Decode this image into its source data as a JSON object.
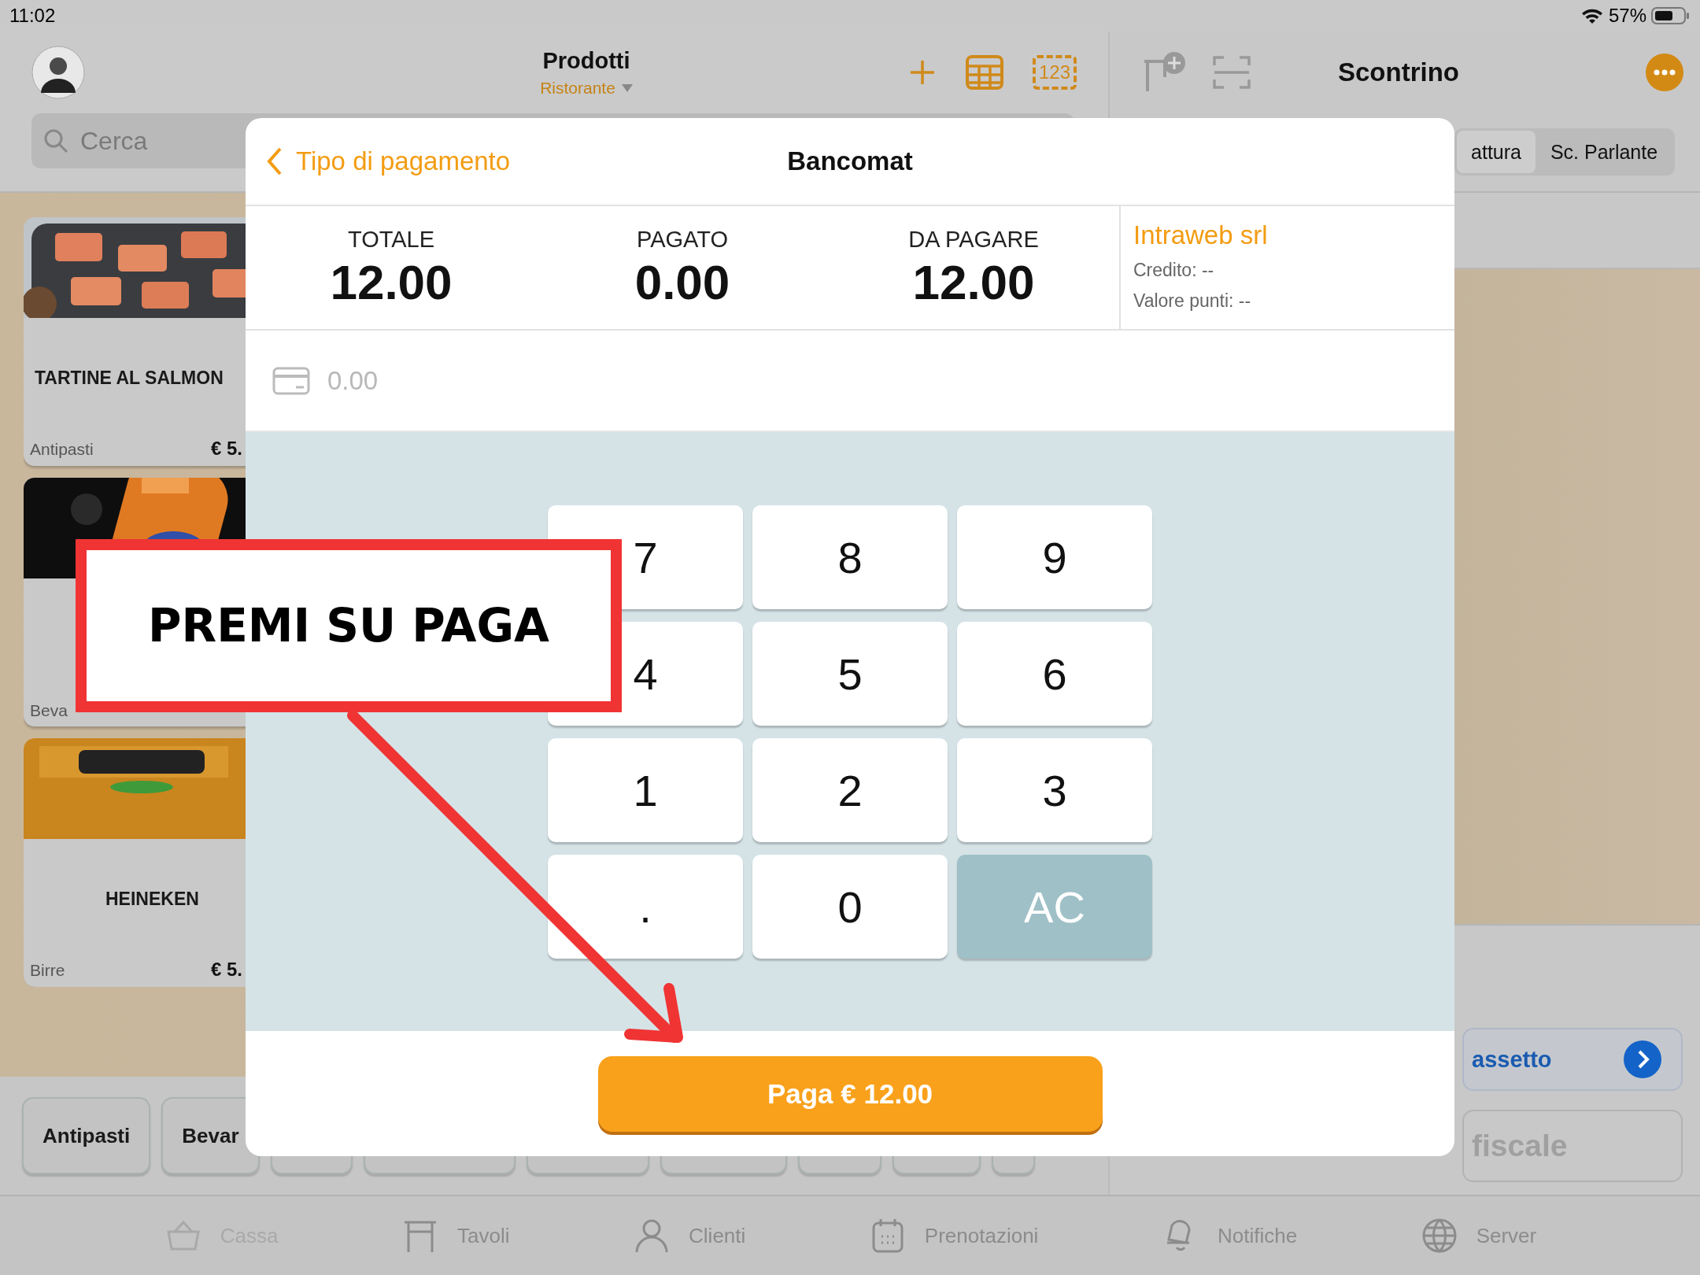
{
  "status_bar": {
    "time": "11:02",
    "battery": "57%"
  },
  "products_panel": {
    "title": "Prodotti",
    "subtitle": "Ristorante",
    "number_pad_label": "123",
    "search": {
      "placeholder": "Cerca"
    },
    "products": [
      {
        "name": "TARTINE AL SALMON",
        "category": "Antipasti",
        "price": "€ 5."
      },
      {
        "category": "Beva"
      },
      {
        "name": "HEINEKEN",
        "category": "Birre",
        "price": "€ 5."
      }
    ],
    "categories": [
      {
        "label": "Antipasti"
      },
      {
        "label": "Bevar"
      }
    ]
  },
  "receipt_panel": {
    "title": "Scontrino",
    "segments": [
      {
        "label": "attura",
        "selected": true
      },
      {
        "label": "Sc. Parlante",
        "selected": false
      }
    ],
    "drawer_button": "assetto",
    "fiscal_button": "fiscale"
  },
  "payment_dialog": {
    "back": "Tipo di pagamento",
    "title": "Bancomat",
    "totals": [
      {
        "label": "TOTALE",
        "value": "12.00"
      },
      {
        "label": "PAGATO",
        "value": "0.00"
      },
      {
        "label": "DA PAGARE",
        "value": "12.00"
      }
    ],
    "customer": {
      "name": "Intraweb srl",
      "lines": [
        "Credito: --",
        "Valore punti: --"
      ]
    },
    "amount": {
      "placeholder": "0.00"
    },
    "keys": [
      {
        "label": "7",
        "kind": "digit"
      },
      {
        "label": "8",
        "kind": "digit"
      },
      {
        "label": "9",
        "kind": "digit"
      },
      {
        "label": "4",
        "kind": "digit"
      },
      {
        "label": "5",
        "kind": "digit"
      },
      {
        "label": "6",
        "kind": "digit"
      },
      {
        "label": "1",
        "kind": "digit"
      },
      {
        "label": "2",
        "kind": "digit"
      },
      {
        "label": "3",
        "kind": "digit"
      },
      {
        "label": ".",
        "kind": "digit"
      },
      {
        "label": "0",
        "kind": "digit"
      },
      {
        "label": "AC",
        "kind": "clear"
      }
    ],
    "pay_button": "Paga € 12.00"
  },
  "annotation": {
    "text": "PREMI SU PAGA"
  },
  "tab_bar": [
    {
      "label": "Cassa",
      "selected": true
    },
    {
      "label": "Tavoli",
      "selected": false
    },
    {
      "label": "Clienti",
      "selected": false
    },
    {
      "label": "Prenotazioni",
      "selected": false
    },
    {
      "label": "Notifiche",
      "selected": false
    },
    {
      "label": "Server",
      "selected": false
    }
  ]
}
